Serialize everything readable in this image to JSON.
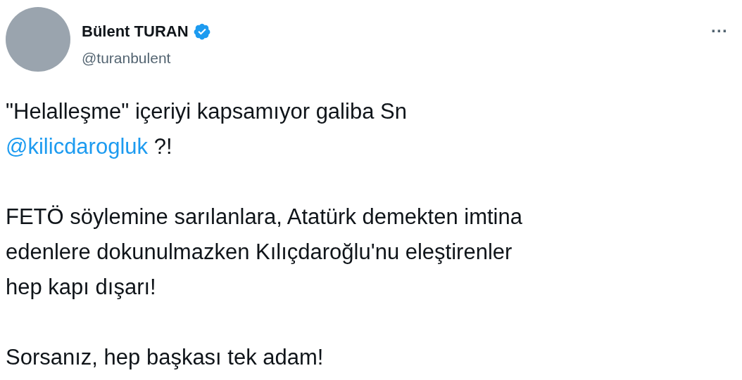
{
  "author": {
    "name": "Bülent TURAN",
    "handle": "@turanbulent",
    "verified": true
  },
  "more": "···",
  "paragraphs": [
    {
      "lines": [
        [
          {
            "kind": "text",
            "text": "\"Helalleşme\" içeriyi kapsamıyor galiba Sn"
          }
        ],
        [
          {
            "kind": "mention",
            "text": "@kilicdarogluk"
          },
          {
            "kind": "text",
            "text": " ?!"
          }
        ]
      ]
    },
    {
      "lines": [
        [
          {
            "kind": "text",
            "text": "FETÖ söylemine sarılanlara, Atatürk demekten imtina"
          }
        ],
        [
          {
            "kind": "text",
            "text": "edenlere dokunulmazken Kılıçdaroğlu'nu eleştirenler"
          }
        ],
        [
          {
            "kind": "text",
            "text": "hep kapı dışarı!"
          }
        ]
      ]
    },
    {
      "lines": [
        [
          {
            "kind": "text",
            "text": "Sorsanız, hep başkası tek adam!"
          }
        ]
      ]
    }
  ]
}
